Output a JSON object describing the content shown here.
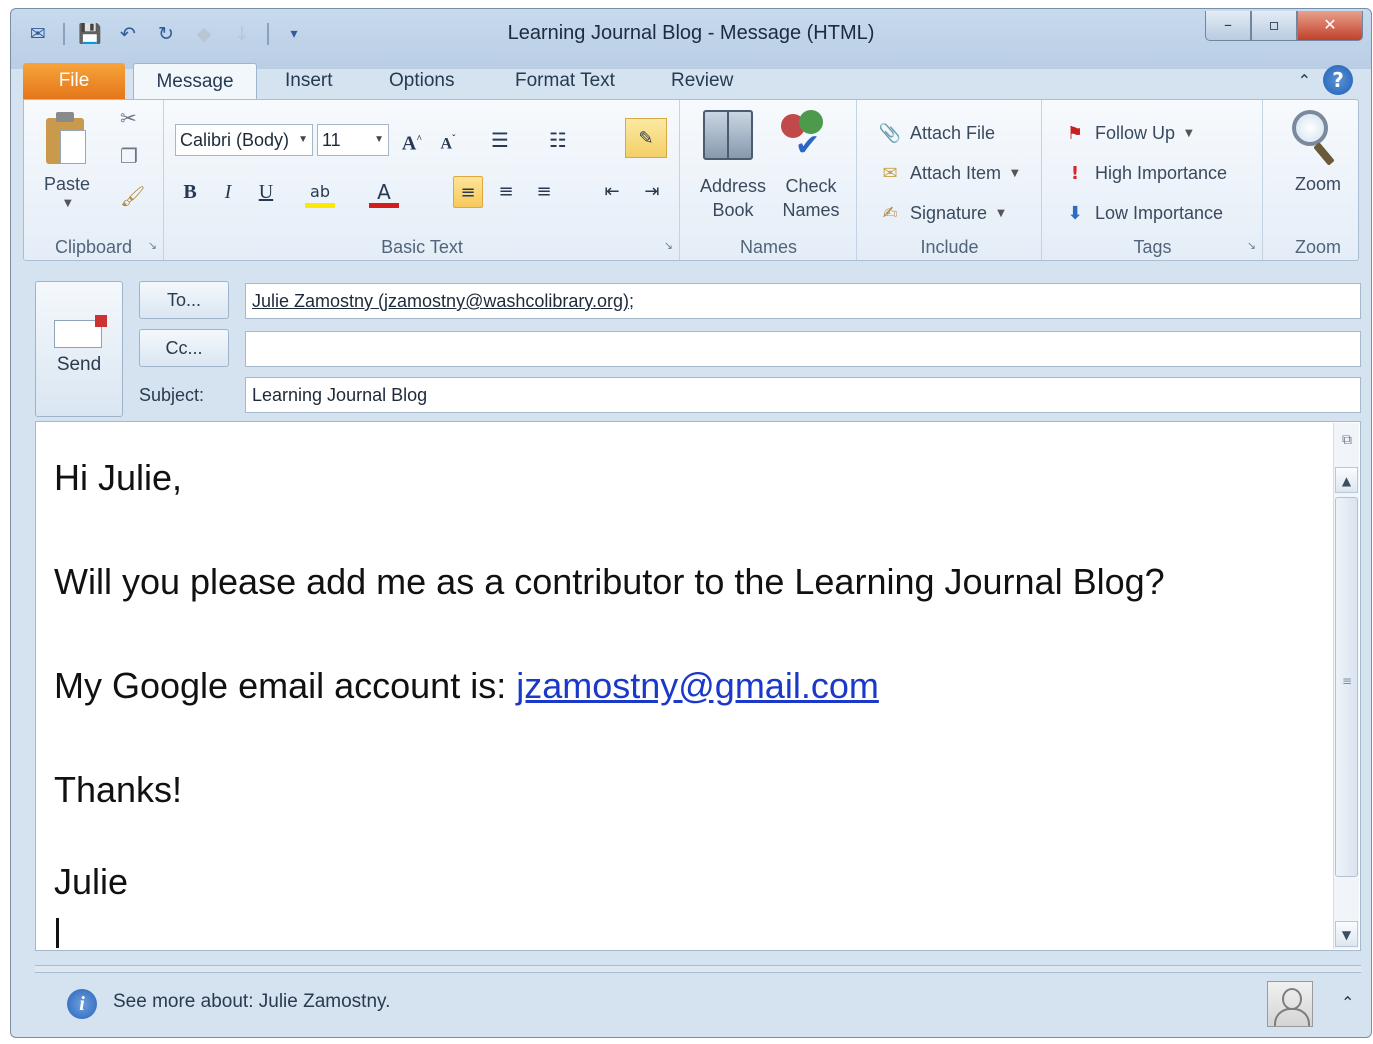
{
  "window": {
    "title": "Learning Journal Blog  -  Message (HTML)",
    "controls": {
      "minimize": "–",
      "maximize": "▫",
      "close": "✕"
    }
  },
  "qat": [
    {
      "name": "outlook-app-icon",
      "glyph": "✉"
    },
    {
      "name": "save-icon",
      "glyph": "💾"
    },
    {
      "name": "undo-icon",
      "glyph": "↶"
    },
    {
      "name": "redo-icon",
      "glyph": "↻"
    },
    {
      "name": "previous-item-icon",
      "glyph": "◆"
    },
    {
      "name": "next-item-icon",
      "glyph": "↓"
    }
  ],
  "ribbon_tabs": {
    "file": "File",
    "message": "Message",
    "insert": "Insert",
    "options": "Options",
    "format_text": "Format Text",
    "review": "Review"
  },
  "ribbon": {
    "clipboard": {
      "label": "Clipboard",
      "paste": "Paste"
    },
    "basic_text": {
      "label": "Basic Text",
      "font": "Calibri (Body)",
      "size": "11",
      "bold": "B",
      "italic": "I",
      "underline": "U"
    },
    "names": {
      "label": "Names",
      "address_book_l1": "Address",
      "address_book_l2": "Book",
      "check_names_l1": "Check",
      "check_names_l2": "Names"
    },
    "include": {
      "label": "Include",
      "attach_file": "Attach File",
      "attach_item": "Attach Item",
      "signature": "Signature"
    },
    "tags": {
      "label": "Tags",
      "follow_up": "Follow Up",
      "high_importance": "High Importance",
      "low_importance": "Low Importance"
    },
    "zoom": {
      "label": "Zoom",
      "button": "Zoom"
    }
  },
  "header": {
    "send_label": "Send",
    "to_button": "To...",
    "cc_button": "Cc...",
    "subject_label": "Subject:",
    "to_value": "Julie Zamostny (jzamostny@washcolibrary.org);",
    "cc_value": "",
    "subject_value": "Learning Journal Blog"
  },
  "body": {
    "greeting": "Hi Julie,",
    "request": "Will you please add me as a contributor to the Learning Journal Blog?",
    "account_prefix": "My Google email account is: ",
    "account_email": "jzamostny@gmail.com",
    "thanks": "Thanks!",
    "signature": "Julie"
  },
  "people_pane": {
    "text": "See more about: Julie Zamostny."
  },
  "colors": {
    "file_tab": "#e5761a",
    "link": "#1b39c9",
    "close_button": "#c1412a",
    "window_frame": "#b9cde4"
  }
}
